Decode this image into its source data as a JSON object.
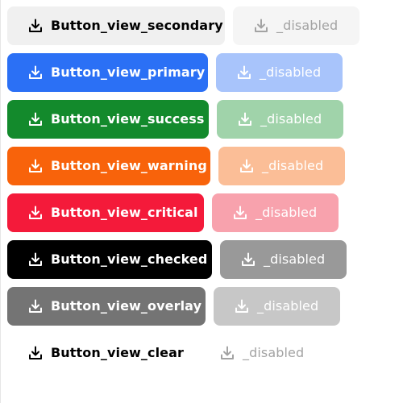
{
  "rows": [
    {
      "view": "secondary",
      "label": "Button_view_secondary",
      "disabled_label": "_disabled",
      "colors": {
        "bg": "#f0f0f0",
        "fg": "#000000",
        "disabled_bg": "#f5f5f5",
        "disabled_fg": "#a3a3a3"
      }
    },
    {
      "view": "primary",
      "label": "Button_view_primary",
      "disabled_label": "_disabled",
      "colors": {
        "bg": "#2b70f5",
        "fg": "#ffffff",
        "disabled_bg": "#a8c4fb",
        "disabled_fg": "#ffffff"
      }
    },
    {
      "view": "success",
      "label": "Button_view_success",
      "disabled_label": "_disabled",
      "colors": {
        "bg": "#138a2c",
        "fg": "#ffffff",
        "disabled_bg": "#a0d3aa",
        "disabled_fg": "#ffffff"
      }
    },
    {
      "view": "warning",
      "label": "Button_view_warning",
      "disabled_label": "_disabled",
      "colors": {
        "bg": "#f8630b",
        "fg": "#ffffff",
        "disabled_bg": "#fbbe97",
        "disabled_fg": "#ffffff"
      }
    },
    {
      "view": "critical",
      "label": "Button_view_critical",
      "disabled_label": "_disabled",
      "colors": {
        "bg": "#f41a3a",
        "fg": "#ffffff",
        "disabled_bg": "#f8a2ad",
        "disabled_fg": "#ffffff"
      }
    },
    {
      "view": "checked",
      "label": "Button_view_checked",
      "disabled_label": "_disabled",
      "colors": {
        "bg": "#000000",
        "fg": "#ffffff",
        "disabled_bg": "#999999",
        "disabled_fg": "#ffffff"
      }
    },
    {
      "view": "overlay",
      "label": "Button_view_overlay",
      "disabled_label": "_disabled",
      "colors": {
        "bg": "#747474",
        "fg": "#ffffff",
        "disabled_bg": "#c7c7c7",
        "disabled_fg": "#ffffff"
      }
    },
    {
      "view": "clear",
      "label": "Button_view_clear",
      "disabled_label": "_disabled",
      "colors": {
        "bg": "transparent",
        "fg": "#000000",
        "disabled_bg": "transparent",
        "disabled_fg": "#a3a3a3"
      }
    }
  ],
  "icon": "download-icon"
}
